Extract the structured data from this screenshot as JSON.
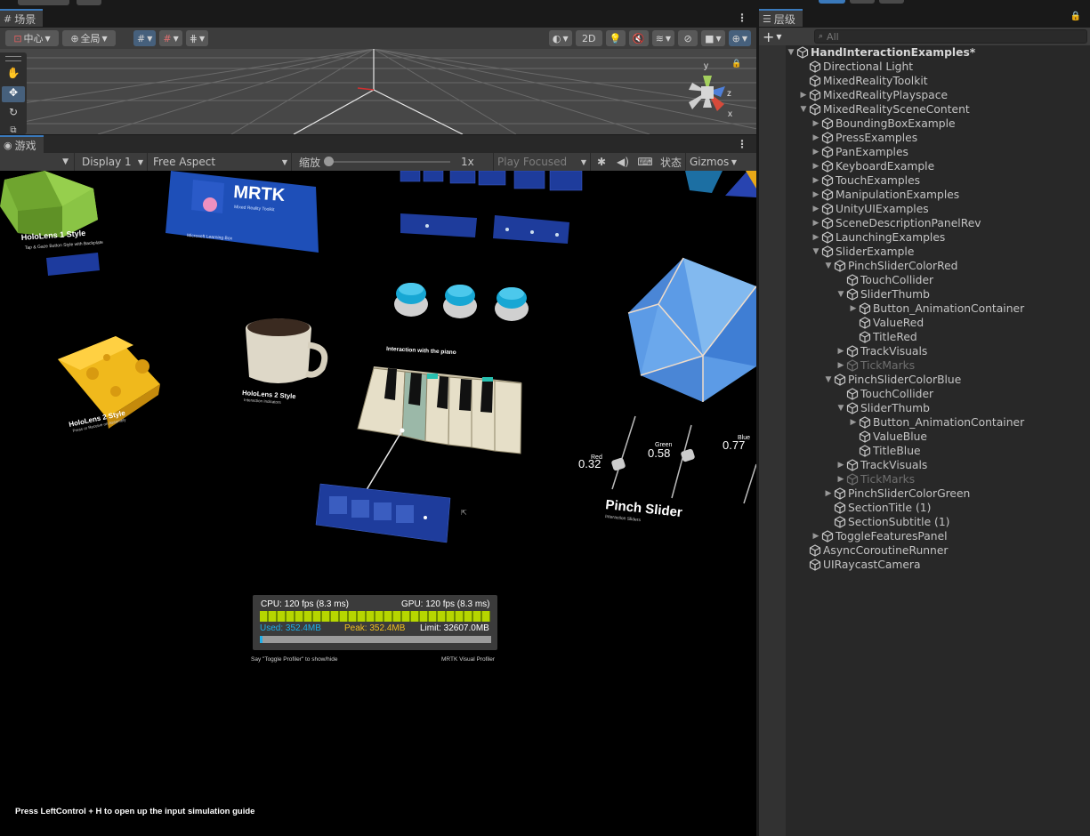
{
  "top_strip": {},
  "scene": {
    "tab_label": "场景",
    "pivot_label": "中心",
    "space_label": "全局",
    "mode_2d": "2D"
  },
  "game": {
    "tab_label": "游戏",
    "display": "Display 1",
    "aspect": "Free Aspect",
    "scale_label": "缩放",
    "scale_value": "1x",
    "play_mode": "Play Focused",
    "stats_label": "状态",
    "gizmos_label": "Gizmos",
    "hint": "Press LeftControl + H to open up the input simulation guide",
    "content": {
      "mrtk_logo": "MRTK",
      "mrtk_sub": "Mixed Reality Toolkit",
      "mrtk_caption": "Microsoft Learning Box",
      "holo1_title": "HoloLens 1 Style",
      "holo1_sub": "Tap & Gaze Button Style with Backplate",
      "holo2_title": "HoloLens 2 Style",
      "holo2_sub": "Interaction Indicators",
      "holo2b_title": "HoloLens 2 Style",
      "holo2b_sub": "Press or Receive on Assembly",
      "piano_label": "Interaction with the piano",
      "slider_red_label": "Red",
      "slider_red_value": "0.32",
      "slider_green_label": "Green",
      "slider_green_value": "0.58",
      "slider_blue_label": "Blue",
      "slider_blue_value": "0.77",
      "pinch_title": "Pinch Slider",
      "pinch_sub": "Interaction Sliders",
      "profiler": {
        "cpu": "CPU: 120 fps (8.3 ms)",
        "gpu": "GPU: 120 fps (8.3 ms)",
        "used": "Used: 352.4MB",
        "peak": "Peak: 352.4MB",
        "limit": "Limit: 32607.0MB",
        "toggle_hint": "Say \"Toggle Profiler\" to show/hide",
        "brand": "MRTK Visual Profiler"
      }
    }
  },
  "hierarchy": {
    "tab_label": "层级",
    "search_placeholder": "All",
    "add_label": "+",
    "rows": [
      {
        "label": "HandInteractionExamples*",
        "depth": 0,
        "arrow": "down",
        "root": true
      },
      {
        "label": "Directional Light",
        "depth": 1,
        "arrow": ""
      },
      {
        "label": "MixedRealityToolkit",
        "depth": 1,
        "arrow": ""
      },
      {
        "label": "MixedRealityPlayspace",
        "depth": 1,
        "arrow": "right"
      },
      {
        "label": "MixedRealitySceneContent",
        "depth": 1,
        "arrow": "down"
      },
      {
        "label": "BoundingBoxExample",
        "depth": 2,
        "arrow": "right"
      },
      {
        "label": "PressExamples",
        "depth": 2,
        "arrow": "right"
      },
      {
        "label": "PanExamples",
        "depth": 2,
        "arrow": "right"
      },
      {
        "label": "KeyboardExample",
        "depth": 2,
        "arrow": "right"
      },
      {
        "label": "TouchExamples",
        "depth": 2,
        "arrow": "right"
      },
      {
        "label": "ManipulationExamples",
        "depth": 2,
        "arrow": "right"
      },
      {
        "label": "UnityUIExamples",
        "depth": 2,
        "arrow": "right"
      },
      {
        "label": "SceneDescriptionPanelRev",
        "depth": 2,
        "arrow": "right"
      },
      {
        "label": "LaunchingExamples",
        "depth": 2,
        "arrow": "right"
      },
      {
        "label": "SliderExample",
        "depth": 2,
        "arrow": "down"
      },
      {
        "label": "PinchSliderColorRed",
        "depth": 3,
        "arrow": "down"
      },
      {
        "label": "TouchCollider",
        "depth": 4,
        "arrow": ""
      },
      {
        "label": "SliderThumb",
        "depth": 4,
        "arrow": "down"
      },
      {
        "label": "Button_AnimationContainer",
        "depth": 5,
        "arrow": "right"
      },
      {
        "label": "ValueRed",
        "depth": 5,
        "arrow": ""
      },
      {
        "label": "TitleRed",
        "depth": 5,
        "arrow": ""
      },
      {
        "label": "TrackVisuals",
        "depth": 4,
        "arrow": "right"
      },
      {
        "label": "TickMarks",
        "depth": 4,
        "arrow": "right",
        "dim": true
      },
      {
        "label": "PinchSliderColorBlue",
        "depth": 3,
        "arrow": "down"
      },
      {
        "label": "TouchCollider",
        "depth": 4,
        "arrow": ""
      },
      {
        "label": "SliderThumb",
        "depth": 4,
        "arrow": "down"
      },
      {
        "label": "Button_AnimationContainer",
        "depth": 5,
        "arrow": "right"
      },
      {
        "label": "ValueBlue",
        "depth": 5,
        "arrow": ""
      },
      {
        "label": "TitleBlue",
        "depth": 5,
        "arrow": ""
      },
      {
        "label": "TrackVisuals",
        "depth": 4,
        "arrow": "right"
      },
      {
        "label": "TickMarks",
        "depth": 4,
        "arrow": "right",
        "dim": true
      },
      {
        "label": "PinchSliderColorGreen",
        "depth": 3,
        "arrow": "right"
      },
      {
        "label": "SectionTitle (1)",
        "depth": 3,
        "arrow": ""
      },
      {
        "label": "SectionSubtitle (1)",
        "depth": 3,
        "arrow": ""
      },
      {
        "label": "ToggleFeaturesPanel",
        "depth": 2,
        "arrow": "right"
      },
      {
        "label": "AsyncCoroutineRunner",
        "depth": 1,
        "arrow": ""
      },
      {
        "label": "UIRaycastCamera",
        "depth": 1,
        "arrow": ""
      }
    ]
  },
  "gizmo_axes": {
    "x": "x",
    "y": "y",
    "z": "z"
  }
}
